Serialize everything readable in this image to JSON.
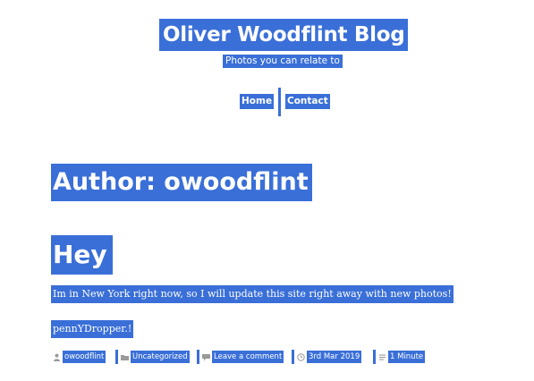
{
  "site": {
    "title": "Oliver Woodflint Blog",
    "description": "Photos you can relate to"
  },
  "nav": {
    "items": [
      {
        "label": "Home"
      },
      {
        "label": "Contact"
      }
    ]
  },
  "archive": {
    "title": "Author: owoodflint"
  },
  "post": {
    "title": "Hey",
    "paragraphs": [
      "Im in New York right now, so I will update this site right away with new photos!",
      "pennYDropper.!"
    ],
    "meta": {
      "author": "owoodflint",
      "category": "Uncategorized",
      "comments": "Leave a comment",
      "date": "3rd Mar 2019",
      "read_time": "1 Minute"
    }
  },
  "colors": {
    "highlight": "#3a6fd8",
    "text_on_highlight": "#ffffff",
    "meta_icon": "#9a9a9a"
  },
  "icons": {
    "author": "user-icon",
    "category": "folder-icon",
    "comments": "comment-icon",
    "date": "clock-icon",
    "read_time": "document-icon"
  }
}
